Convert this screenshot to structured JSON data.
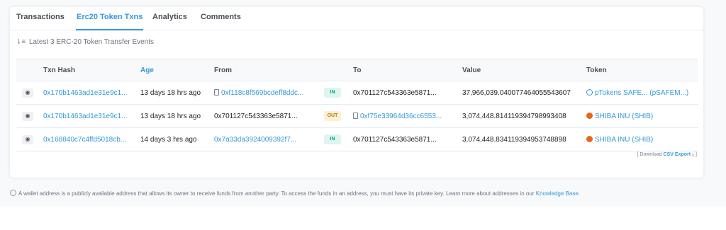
{
  "tabs": [
    "Transactions",
    "Erc20 Token Txns",
    "Analytics",
    "Comments"
  ],
  "summary": "Latest 3 ERC-20 Token Transfer Events",
  "columns": {
    "txn": "Txn Hash",
    "age": "Age",
    "from": "From",
    "to": "To",
    "value": "Value",
    "token": "Token"
  },
  "rows": [
    {
      "hash": "0x170b1463ad1e31e9c1...",
      "age": "13 days 18 hrs ago",
      "from": "0xf118c8f569bcdeff8ddc...",
      "direction": "IN",
      "to": "0x701127c543363e5871...",
      "value": "37,966,039.040077464055543607",
      "token": "pTokens SAFE... (pSAFEM...)"
    },
    {
      "hash": "0x170b1463ad1e31e9c1...",
      "age": "13 days 18 hrs ago",
      "from": "0x701127c543363e5871...",
      "direction": "OUT",
      "to": "0xf75e33964d36cc6553...",
      "value": "3,074,448.814119394798993408",
      "token": "SHIBA INU (SHIB)"
    },
    {
      "hash": "0x168840c7c4ffd5018cb...",
      "age": "14 days 3 hrs ago",
      "from": "0x7a33da3924009392f7...",
      "direction": "IN",
      "to": "0x701127c543363e5871...",
      "value": "3,074,448.834119394953748898",
      "token": "SHIBA INU (SHIB)"
    }
  ],
  "download": {
    "prefix": "[ Download",
    "csv": "CSV Export",
    "suffix": "]"
  },
  "footer": {
    "text": "A wallet address is a publicly available address that allows its owner to receive funds from another party. To access the funds in an address, you must have its private key. Learn more about addresses in our",
    "link": "Knowledge Base",
    "end": "."
  },
  "colors": {
    "accent": "#3498db",
    "in_badge": "#00a186",
    "out_badge": "#b47d00"
  }
}
